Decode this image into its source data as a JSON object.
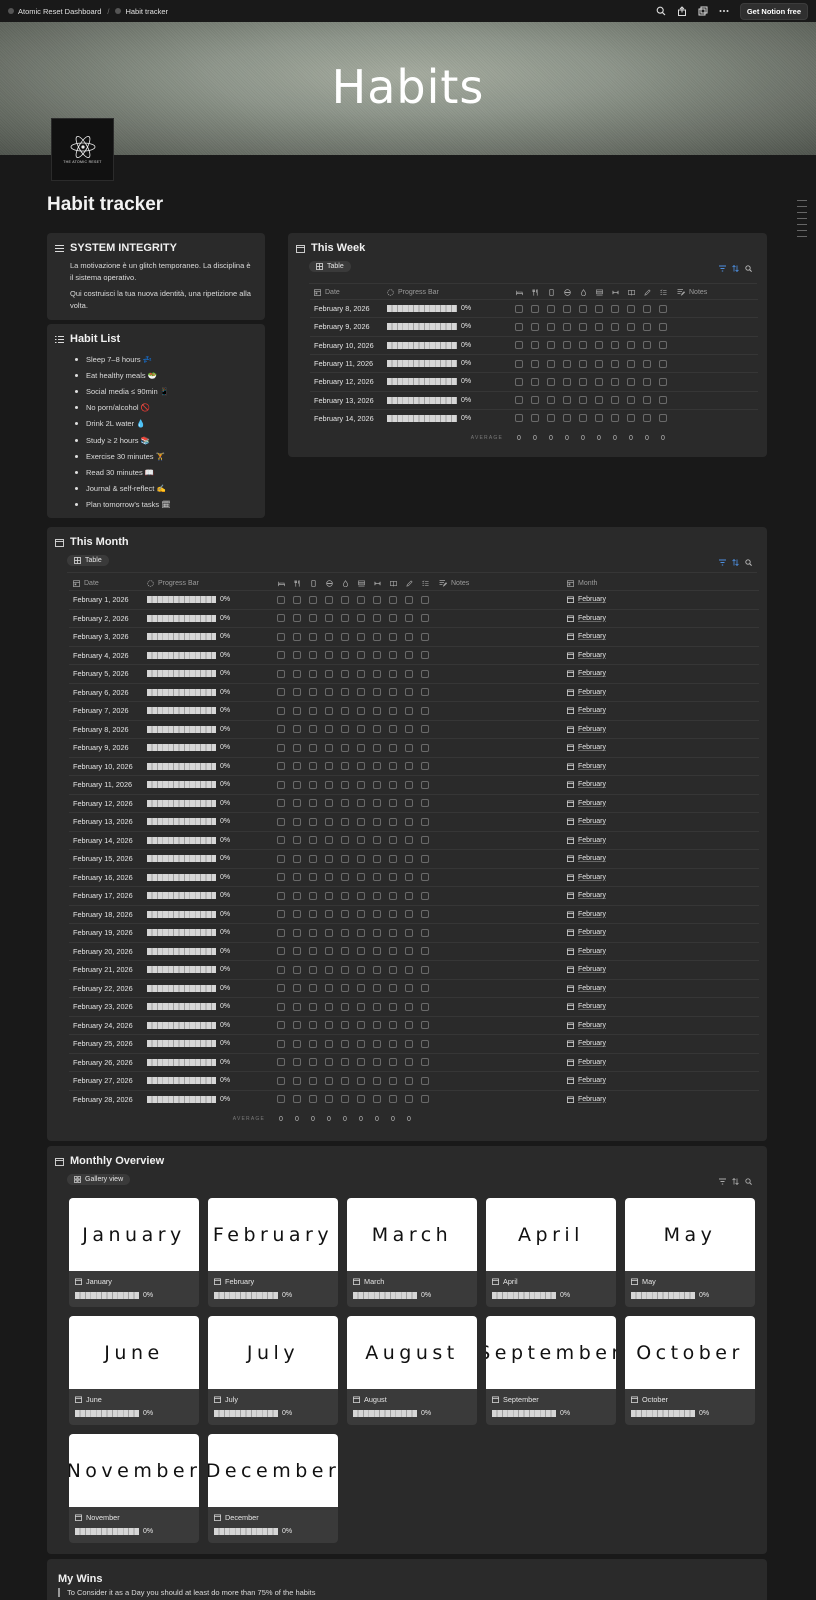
{
  "topbar": {
    "crumbs": [
      "Atomic Reset Dashboard",
      "Habit tracker"
    ],
    "cta": "Get Notion free",
    "icons": [
      "search-icon",
      "share-icon",
      "duplicate-icon",
      "more-icon"
    ]
  },
  "cover": {
    "title": "Habits"
  },
  "page": {
    "title": "Habit tracker",
    "logo_text": "THE ATOMIC RESET"
  },
  "system": {
    "title": "SYSTEM INTEGRITY",
    "p1": "La motivazione è un glitch temporaneo. La disciplina è il sistema operativo.",
    "p2": "Qui costruisci la tua nuova identità, una ripetizione alla volta."
  },
  "habits": {
    "title": "Habit List",
    "items": [
      "Sleep 7–8 hours 💤",
      "Eat healthy meals 🥗",
      "Social media ≤ 90min 📱",
      "No porn/alcohol 🚫",
      "Drink 2L water 💧",
      "Study ≥ 2 hours 📚",
      "Exercise 30 minutes 🏋",
      "Read 30 minutes 📖",
      "Journal & self-reflect ✍",
      "Plan tomorrow's tasks 🗓"
    ]
  },
  "week": {
    "title": "This Week",
    "view": "Table",
    "col_date": "Date",
    "col_progress": "Progress Bar",
    "col_notes": "Notes",
    "habit_icons": [
      "bed-icon",
      "fork-knife-icon",
      "phone-icon",
      "block-icon",
      "drop-icon",
      "book-stack-icon",
      "dumbbell-icon",
      "open-book-icon",
      "pen-icon",
      "checklist-icon"
    ],
    "rows": [
      "February 8, 2026",
      "February 9, 2026",
      "February 10, 2026",
      "February 11, 2026",
      "February 12, 2026",
      "February 13, 2026",
      "February 14, 2026"
    ],
    "progress": "0%",
    "progress_value": 0,
    "avg_label": "AVERAGE",
    "avg_values": [
      "0",
      "0",
      "0",
      "0",
      "0",
      "0",
      "0",
      "0",
      "0",
      "0"
    ]
  },
  "month": {
    "title": "This Month",
    "view": "Table",
    "col_date": "Date",
    "col_progress": "Progress Bar",
    "col_notes": "Notes",
    "col_month": "Month",
    "month_value": "February",
    "rows": [
      "February 1, 2026",
      "February 2, 2026",
      "February 3, 2026",
      "February 4, 2026",
      "February 5, 2026",
      "February 6, 2026",
      "February 7, 2026",
      "February 8, 2026",
      "February 9, 2026",
      "February 10, 2026",
      "February 11, 2026",
      "February 12, 2026",
      "February 13, 2026",
      "February 14, 2026",
      "February 15, 2026",
      "February 16, 2026",
      "February 17, 2026",
      "February 18, 2026",
      "February 19, 2026",
      "February 20, 2026",
      "February 21, 2026",
      "February 22, 2026",
      "February 23, 2026",
      "February 24, 2026",
      "February 25, 2026",
      "February 26, 2026",
      "February 27, 2026",
      "February 28, 2026"
    ],
    "progress": "0%",
    "avg_label": "AVERAGE",
    "avg_values": [
      "0",
      "0",
      "0",
      "0",
      "0",
      "0",
      "0",
      "0",
      "0"
    ]
  },
  "overview": {
    "title": "Monthly Overview",
    "view": "Gallery view",
    "progress": "0%",
    "months": [
      "January",
      "February",
      "March",
      "April",
      "May",
      "June",
      "July",
      "August",
      "September",
      "October",
      "November",
      "December"
    ]
  },
  "wins": {
    "title": "My Wins",
    "quote": "To Consider it as a Day you should at least do more than 75% of the habits"
  },
  "colors": {
    "accent": "#4d8fe0",
    "bg": "#191919",
    "card": "#2a2a2a"
  }
}
